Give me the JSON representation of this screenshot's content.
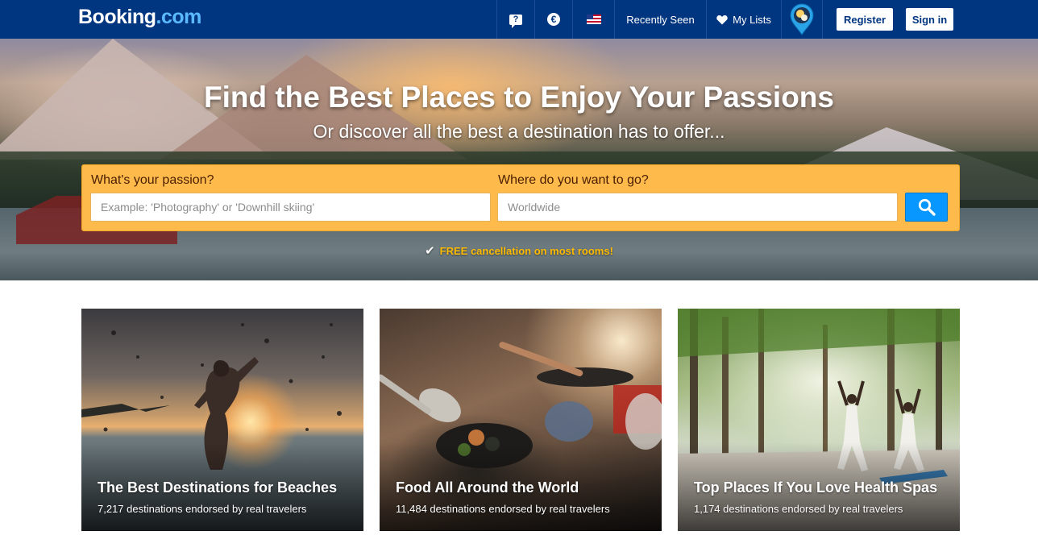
{
  "header": {
    "logo_main": "Booking",
    "logo_suffix": ".com",
    "currency_symbol": "€",
    "help_glyph": "?",
    "recently_seen": "Recently Seen",
    "my_lists": "My Lists",
    "register": "Register",
    "sign_in": "Sign in",
    "icons": [
      "help-chat-icon",
      "currency-euro-icon",
      "us-flag-icon",
      "heart-icon",
      "avatar-pin-icon"
    ]
  },
  "hero": {
    "title": "Find the Best Places to Enjoy Your Passions",
    "subtitle": "Or discover all the best a destination has to offer...",
    "search": {
      "passion_label": "What's your passion?",
      "passion_placeholder": "Example: 'Photography' or 'Downhill skiing'",
      "where_label": "Where do you want to go?",
      "where_placeholder": "Worldwide",
      "button_icon": "search-icon"
    },
    "free_cancellation": "FREE cancellation on most rooms!"
  },
  "cards": [
    {
      "title": "The Best Destinations for Beaches",
      "subtitle": "7,217 destinations endorsed by real travelers"
    },
    {
      "title": "Food All Around the World",
      "subtitle": "11,484 destinations endorsed by real travelers"
    },
    {
      "title": "Top Places If You Love Health Spas",
      "subtitle": "1,174 destinations endorsed by real travelers"
    }
  ],
  "colors": {
    "brand_blue": "#003580",
    "logo_accent": "#5bbaff",
    "search_yellow": "#febb4c",
    "search_button": "#0896ff",
    "free_cancel_text": "#febb02"
  }
}
